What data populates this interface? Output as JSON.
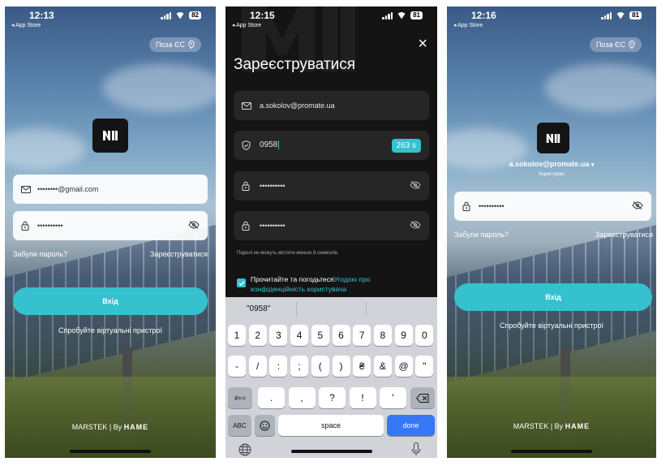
{
  "screen1": {
    "status": {
      "time": "12:13",
      "back": "◂ App Store",
      "battery": "82"
    },
    "region": {
      "label": "Поза ЄС"
    },
    "email_field": {
      "value": "••••••••@gmail.com"
    },
    "password_field": {
      "value": "••••••••••"
    },
    "forgot_link": "Забули пароль?",
    "register_link": "Зареєструватися",
    "login_button": "Вхід",
    "try_link": "Спробуйте віртуальні пристрої",
    "footer": {
      "brand": "MARSTEK",
      "by": "By",
      "partner": "HAME"
    }
  },
  "screen2": {
    "status": {
      "time": "12:15",
      "back": "◂ App Store",
      "battery": "81"
    },
    "close_icon": "×",
    "title": "Зареєструватися",
    "email_field": {
      "value": "a.sokolov@promate.ua"
    },
    "code_field": {
      "value": "0958"
    },
    "timer": "263 s",
    "password_field": {
      "value": "••••••••••"
    },
    "confirm_field": {
      "value": "••••••••••"
    },
    "hint": "Паролі не можуть містити менше 8 символів.",
    "agree_text": "Прочитайте та погодьтеся",
    "agree_link": "Угодою про конфіденційність користувача",
    "suggestion": "\"0958\"",
    "keyboard": {
      "row1": [
        "1",
        "2",
        "3",
        "4",
        "5",
        "6",
        "7",
        "8",
        "9",
        "0"
      ],
      "row2": [
        "-",
        "/",
        ":",
        ";",
        "(",
        ")",
        "₴",
        "&",
        "@",
        "\""
      ],
      "row3_left": "#+=",
      "row3": [
        ".",
        ",",
        "?",
        "!",
        "'"
      ],
      "abc": "ABC",
      "space": "space",
      "done": "done"
    }
  },
  "screen3": {
    "status": {
      "time": "12:16",
      "back": "◂ App Store",
      "battery": "81"
    },
    "region": {
      "label": "Поза ЄС"
    },
    "account": {
      "email": "a.sokolov@promate.ua",
      "role": "Користувач"
    },
    "password_field": {
      "value": "••••••••••"
    },
    "forgot_link": "Забули пароль?",
    "register_link": "Зареєструватися",
    "login_button": "Вхід",
    "try_link": "Спробуйте віртуальні пристрої",
    "footer": {
      "brand": "MARSTEK",
      "by": "By",
      "partner": "HAME"
    }
  },
  "colors": {
    "accent": "#35c1ce",
    "dark_bg": "#141414",
    "done_key": "#3478f6"
  },
  "icons": [
    "mail-icon",
    "lock-icon",
    "eye-off-icon",
    "shield-icon",
    "location-pin-icon",
    "close-icon",
    "backspace-icon",
    "emoji-icon",
    "globe-icon",
    "microphone-icon",
    "checkbox-icon",
    "chevron-down-icon"
  ]
}
